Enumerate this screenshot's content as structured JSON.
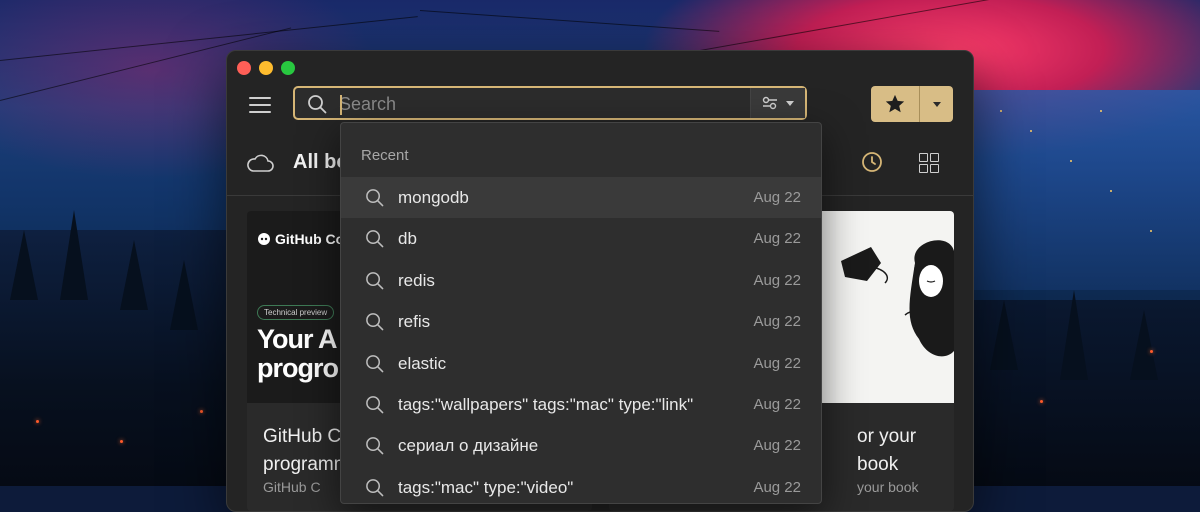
{
  "search": {
    "placeholder": "Search"
  },
  "header": {
    "title": "All bo"
  },
  "dropdown": {
    "heading": "Recent",
    "items": [
      {
        "label": "mongodb",
        "date": "Aug 22",
        "active": true
      },
      {
        "label": "db",
        "date": "Aug 22"
      },
      {
        "label": "redis",
        "date": "Aug 22"
      },
      {
        "label": "refis",
        "date": "Aug 22"
      },
      {
        "label": "elastic",
        "date": "Aug 22"
      },
      {
        "label": "tags:\"wallpapers\" tags:\"mac\" type:\"link\"",
        "date": "Aug 22"
      },
      {
        "label": "сериал о дизайне",
        "date": "Aug 22"
      },
      {
        "label": "tags:\"mac\" type:\"video\"",
        "date": "Aug 22"
      }
    ]
  },
  "cards": {
    "left": {
      "brand": "GitHub Co",
      "badge": "Technical preview",
      "headline_line1": "Your A",
      "headline_line2": "progro",
      "title_line1": "GitHub C",
      "title_line2": "programm",
      "desc": "GitHub C"
    },
    "right": {
      "title_line1": "or your book",
      "desc": "your book"
    }
  },
  "icons": {
    "search": "search-icon",
    "filter": "filter-icon",
    "favorite": "star-icon",
    "cloud": "cloud-icon",
    "clock": "clock-icon",
    "grid": "grid-icon"
  },
  "colors": {
    "accent": "#d6b676",
    "favorite_button": "#d8bd86",
    "window_bg": "#242424",
    "dropdown_bg": "#2e2e2e",
    "dropdown_active": "#3a3a3a"
  }
}
